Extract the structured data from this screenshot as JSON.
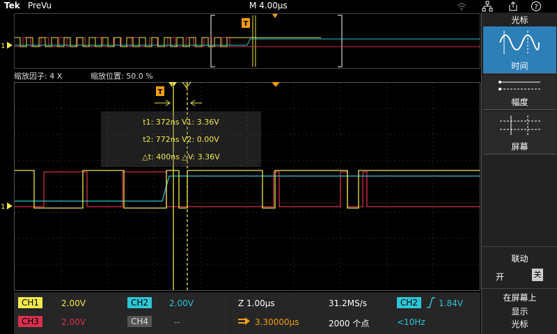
{
  "header": {
    "brand": "Tek",
    "app_title": "PreVu",
    "timebase": "M 4.00µs"
  },
  "icons": {
    "wifi": "wifi-icon",
    "network": "network-icon",
    "export": "export-icon",
    "help": "help-icon"
  },
  "zoom": {
    "factor": "缩放因子: 4 X",
    "position": "缩放位置: 50.0 %"
  },
  "markers": {
    "trigger": "T",
    "cursor1": "1",
    "cursor2": "2",
    "ch_ref_left": "1"
  },
  "measurements": {
    "line1": "t1: 372ns  V1: 3.36V",
    "line2": "t2: 772ns  V2: 0.00V",
    "line3": "△t: 400ns  △V: 3.36V"
  },
  "side_panel": {
    "title": "光标",
    "items": [
      {
        "label": "时间",
        "active": true
      },
      {
        "label": "幅度",
        "active": false
      },
      {
        "label": "屏幕",
        "active": false
      }
    ],
    "link_label": "联动",
    "link_on": "开",
    "link_off": "关",
    "show_line1": "在屏幕上",
    "show_line2": "显示",
    "show_line3": "光标"
  },
  "channels": {
    "ch1": {
      "label": "CH1",
      "value": "2.00V",
      "color": "#f2e94e"
    },
    "ch2": {
      "label": "CH2",
      "value": "2.00V",
      "color": "#2ec6d6"
    },
    "ch3": {
      "label": "CH3",
      "value": "2.00V",
      "color": "#d8304d"
    },
    "ch4": {
      "label": "CH4",
      "value": "--",
      "color": "#888888"
    }
  },
  "acquisition": {
    "zoom_scale": "Z 1.00µs",
    "delay": "3.30000µs",
    "sample_rate": "31.2MS/s",
    "record_length": "2000 个点",
    "trigger_source": "CH2",
    "trigger_level": "1.84V",
    "trigger_freq": "<10Hz"
  },
  "colors": {
    "ch1": "#f2e94e",
    "ch2": "#2ec6d6",
    "ch3": "#d8304d",
    "accent": "#2d7fb8",
    "trigger": "#f39c12"
  }
}
